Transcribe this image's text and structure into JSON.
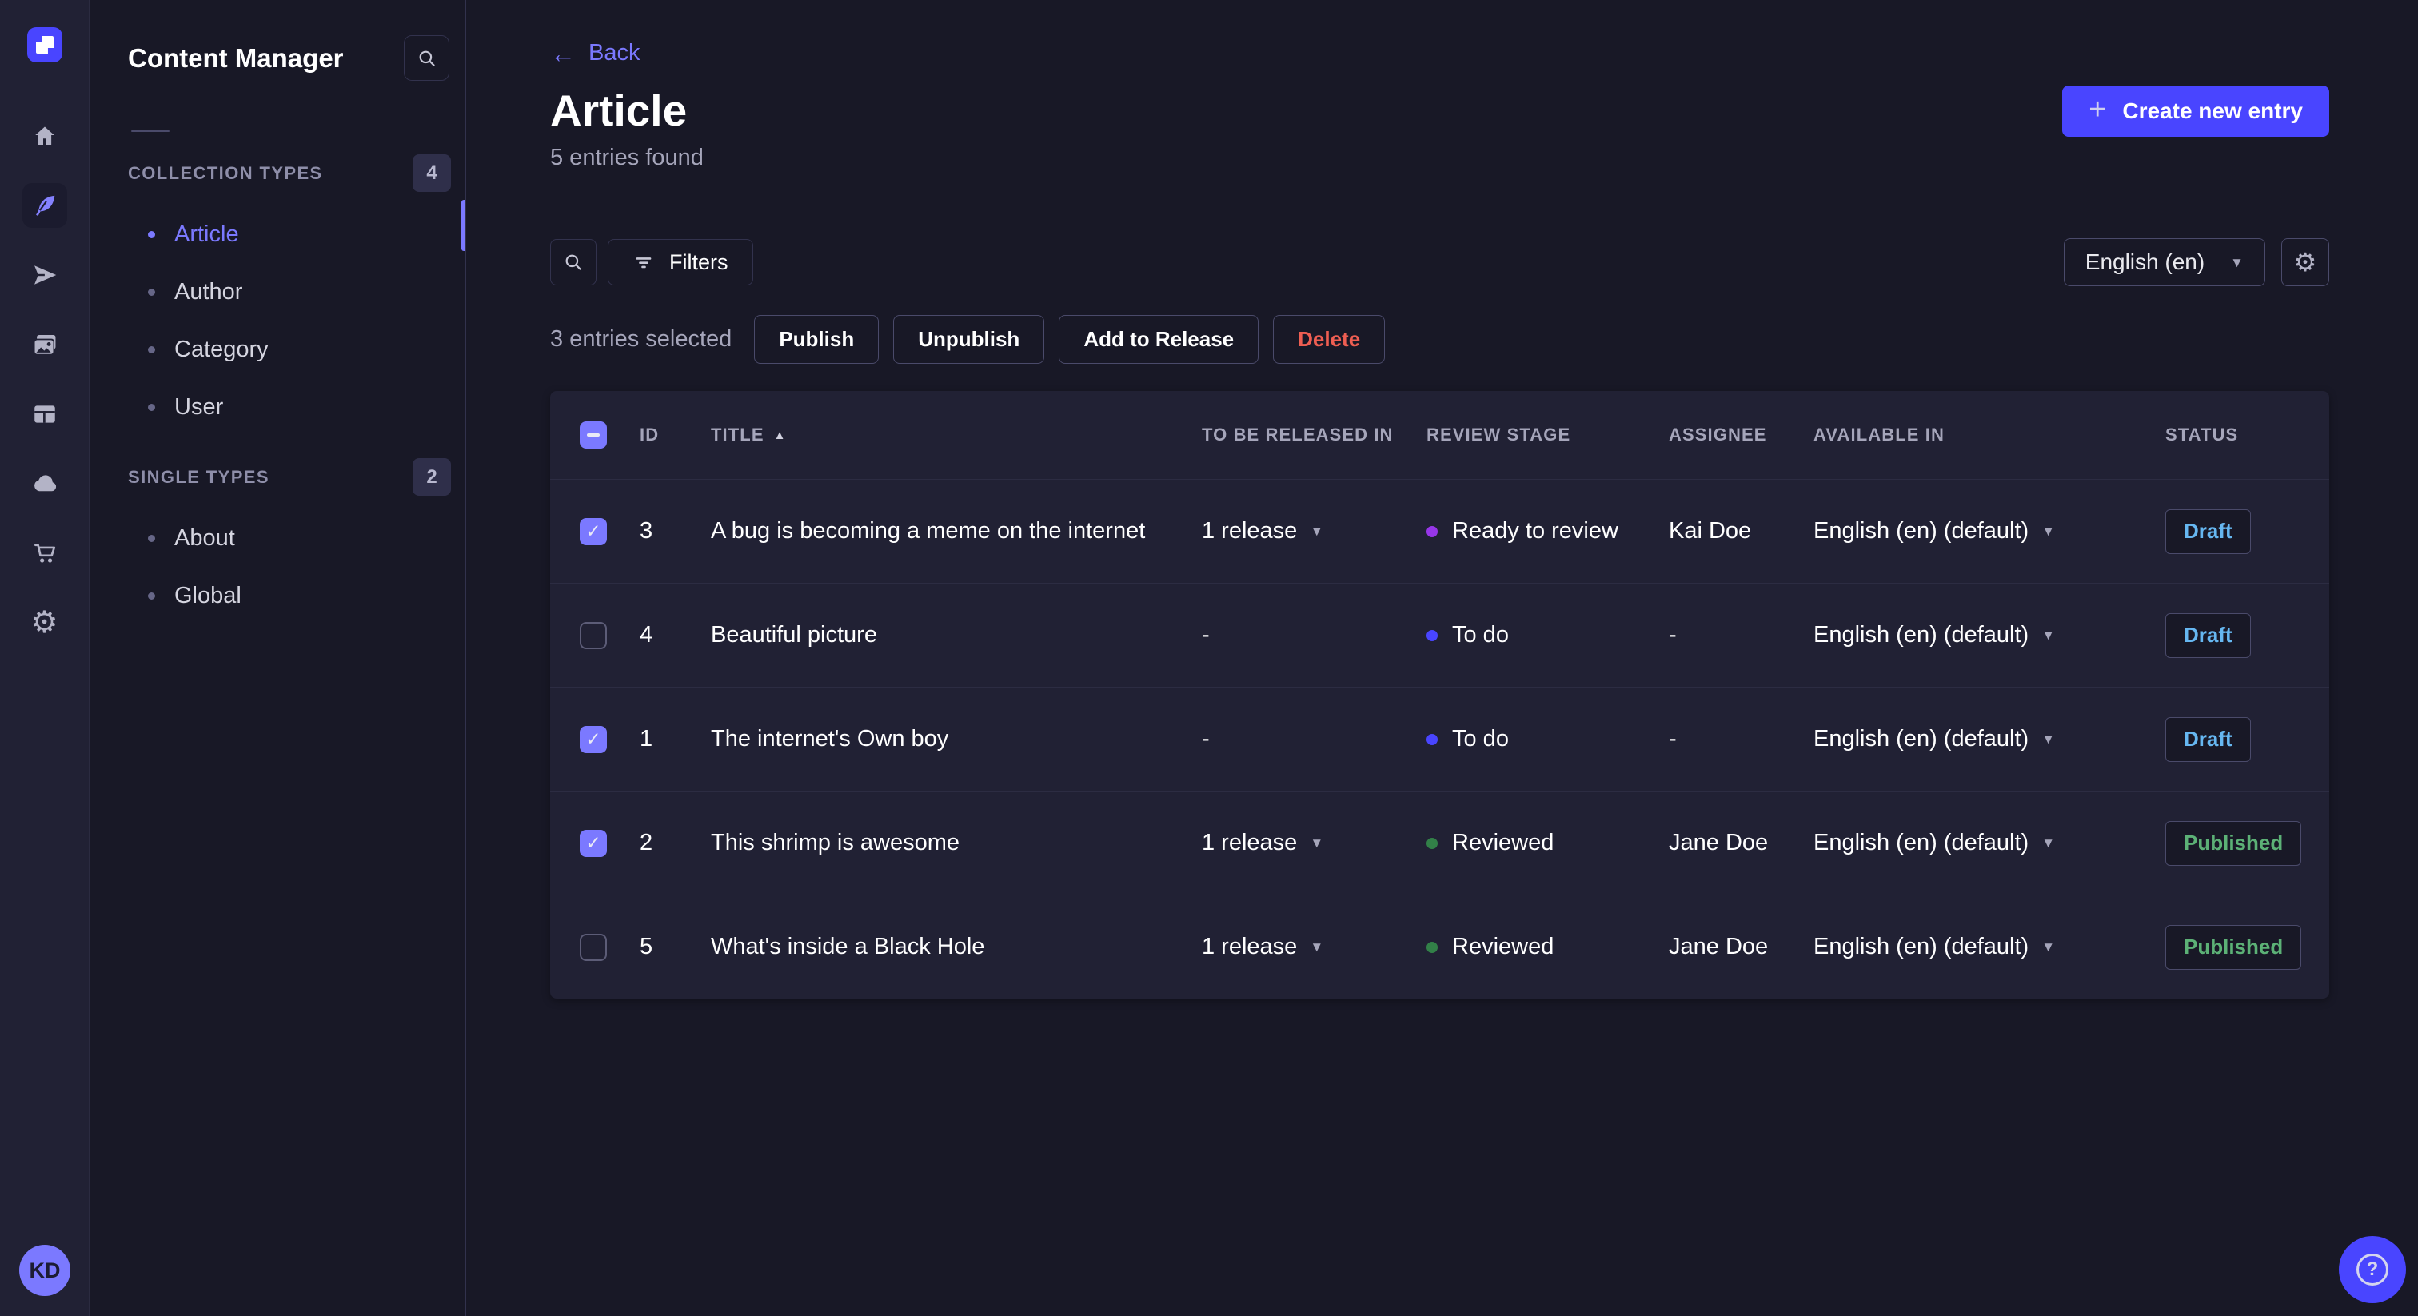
{
  "colors": {
    "primary": "#4945ff",
    "accent": "#7b79ff",
    "page_bg": "#181826",
    "panel_bg": "#212134",
    "border": "#4a4a6a",
    "muted_text": "#a5a5ba",
    "danger": "#ee5e52"
  },
  "icons": {
    "back_arrow": "←",
    "sort_asc": "▲",
    "caret_down": "▼",
    "checkmark": "✓",
    "plus": "+",
    "gear": "⚙",
    "question_mark": "?"
  },
  "rail": {
    "icons": [
      "strapi-logo",
      "home",
      "content-manager-feather",
      "releases-paper-plane",
      "media-library-pictures",
      "content-type-builder-layout",
      "cloud",
      "marketplace-cart",
      "settings-gear"
    ],
    "active_icon": "content-manager-feather",
    "user_initials": "KD"
  },
  "sidebar": {
    "title": "Content Manager",
    "sections": [
      {
        "label": "COLLECTION TYPES",
        "badge": "4",
        "items": [
          {
            "label": "Article",
            "active": true
          },
          {
            "label": "Author",
            "active": false
          },
          {
            "label": "Category",
            "active": false
          },
          {
            "label": "User",
            "active": false
          }
        ]
      },
      {
        "label": "SINGLE TYPES",
        "badge": "2",
        "items": [
          {
            "label": "About",
            "active": false
          },
          {
            "label": "Global",
            "active": false
          }
        ]
      }
    ]
  },
  "header": {
    "back_label": "Back",
    "title": "Article",
    "subtitle": "5 entries found",
    "create_button_label": "Create new entry"
  },
  "toolbar": {
    "filters_label": "Filters",
    "locale_value": "English (en)"
  },
  "selection": {
    "text": "3 entries selected",
    "actions": [
      {
        "label": "Publish",
        "danger": false
      },
      {
        "label": "Unpublish",
        "danger": false
      },
      {
        "label": "Add to Release",
        "danger": false
      },
      {
        "label": "Delete",
        "danger": true
      }
    ]
  },
  "table": {
    "columns": [
      "ID",
      "TITLE",
      "TO BE RELEASED IN",
      "REVIEW STAGE",
      "ASSIGNEE",
      "AVAILABLE IN",
      "STATUS"
    ],
    "sort": {
      "column": "TITLE",
      "direction": "asc"
    },
    "header_checkbox": "indeterminate",
    "status_colors": {
      "Draft": "#66b7f1",
      "Published": "#5cb176"
    },
    "rows": [
      {
        "checked": true,
        "id": "3",
        "title": "A bug is becoming a meme on the internet",
        "to_be_released_in": "1 release",
        "review_stage": "Ready to review",
        "stage_color": "#9736e8",
        "assignee": "Kai Doe",
        "available_in": "English (en) (default)",
        "status": "Draft"
      },
      {
        "checked": false,
        "id": "4",
        "title": "Beautiful picture",
        "to_be_released_in": "-",
        "review_stage": "To do",
        "stage_color": "#4945ff",
        "assignee": "-",
        "available_in": "English (en) (default)",
        "status": "Draft"
      },
      {
        "checked": true,
        "id": "1",
        "title": "The internet's Own boy",
        "to_be_released_in": "-",
        "review_stage": "To do",
        "stage_color": "#4945ff",
        "assignee": "-",
        "available_in": "English (en) (default)",
        "status": "Draft"
      },
      {
        "checked": true,
        "id": "2",
        "title": "This shrimp is awesome",
        "to_be_released_in": "1 release",
        "review_stage": "Reviewed",
        "stage_color": "#328048",
        "assignee": "Jane Doe",
        "available_in": "English (en) (default)",
        "status": "Published"
      },
      {
        "checked": false,
        "id": "5",
        "title": "What's inside a Black Hole",
        "to_be_released_in": "1 release",
        "review_stage": "Reviewed",
        "stage_color": "#328048",
        "assignee": "Jane Doe",
        "available_in": "English (en) (default)",
        "status": "Published"
      }
    ]
  }
}
